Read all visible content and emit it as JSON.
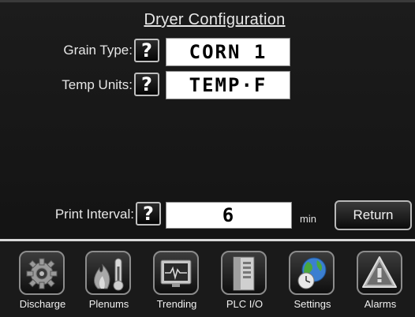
{
  "screen": {
    "title": "Dryer Configuration"
  },
  "fields": {
    "grain_type": {
      "label": "Grain Type:",
      "help": "?",
      "value": "CORN 1"
    },
    "temp_units": {
      "label": "Temp Units:",
      "help": "?",
      "value": "TEMP·F"
    },
    "print_interval": {
      "label": "Print Interval:",
      "help": "?",
      "value": "6",
      "unit": "min"
    }
  },
  "buttons": {
    "return": "Return"
  },
  "nav": [
    {
      "label": "Discharge",
      "icon": "gear-icon"
    },
    {
      "label": "Plenums",
      "icon": "flame-thermometer-icon"
    },
    {
      "label": "Trending",
      "icon": "monitor-pulse-icon"
    },
    {
      "label": "PLC I/O",
      "icon": "plc-rack-icon"
    },
    {
      "label": "Settings",
      "icon": "globe-clock-icon"
    },
    {
      "label": "Alarms",
      "icon": "warning-triangle-icon"
    }
  ]
}
